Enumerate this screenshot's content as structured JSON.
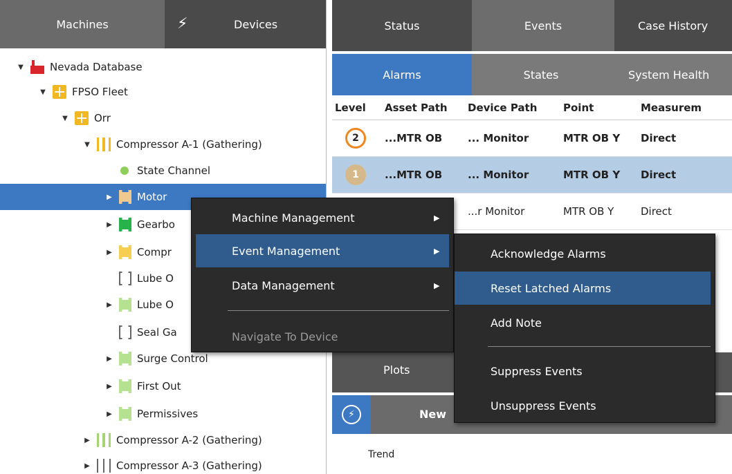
{
  "left_tabs": {
    "machines": "Machines",
    "devices": "Devices"
  },
  "tree": [
    {
      "label": "Nevada Database",
      "icon": "factory-icon",
      "caret": "▼"
    },
    {
      "label": "FPSO Fleet",
      "icon": "folder-grid-icon",
      "caret": "▼"
    },
    {
      "label": "Orr",
      "icon": "folder-grid-icon",
      "caret": "▼"
    },
    {
      "label": "Compressor A-1 (Gathering)",
      "icon": "machine-train-icon",
      "caret": "▼"
    },
    {
      "label": "State Channel",
      "icon": "status-dot-icon",
      "caret": ""
    },
    {
      "label": "Motor",
      "icon": "motor-icon",
      "caret": "▶"
    },
    {
      "label": "Gearbo",
      "icon": "gearbox-icon",
      "caret": "▶"
    },
    {
      "label": "Compr",
      "icon": "compressor-icon",
      "caret": "▶"
    },
    {
      "label": "Lube O",
      "icon": "component-outline-icon",
      "caret": ""
    },
    {
      "label": "Lube O",
      "icon": "component-light-icon",
      "caret": "▶"
    },
    {
      "label": "Seal Ga",
      "icon": "component-outline-icon",
      "caret": ""
    },
    {
      "label": "Surge Control",
      "icon": "component-light-icon",
      "caret": "▶"
    },
    {
      "label": "First Out",
      "icon": "component-light-icon",
      "caret": "▶"
    },
    {
      "label": "Permissives",
      "icon": "component-light-icon",
      "caret": "▶"
    },
    {
      "label": "Compressor A-2 (Gathering)",
      "icon": "machine-train-green-icon",
      "caret": "▶"
    },
    {
      "label": "Compressor A-3 (Gathering)",
      "icon": "machine-train-outline-icon",
      "caret": "▶"
    }
  ],
  "right_tabs": {
    "status": "Status",
    "events": "Events",
    "case_history": "Case History"
  },
  "sub_tabs": {
    "alarms": "Alarms",
    "states": "States",
    "system_health": "System Health"
  },
  "grid": {
    "headers": [
      "Level",
      "Asset Path",
      "Device Path",
      "Point",
      "Measurem"
    ],
    "rows": [
      {
        "level": "2",
        "asset": "...MTR OB",
        "device": "... Monitor",
        "point": "MTR OB Y",
        "meas": "Direct"
      },
      {
        "level": "1",
        "asset": "...MTR OB",
        "device": "... Monitor",
        "point": "MTR OB Y",
        "meas": "Direct"
      },
      {
        "level": "",
        "asset": "",
        "device": "...r Monitor",
        "point": "MTR OB Y",
        "meas": "Direct"
      }
    ]
  },
  "plots": {
    "label": "Plots"
  },
  "new_bar": {
    "label": "New"
  },
  "trend": {
    "label": "Trend"
  },
  "context_menu": {
    "items": [
      {
        "label": "Machine Management",
        "submenu": true
      },
      {
        "label": "Event Management",
        "submenu": true
      },
      {
        "label": "Data Management",
        "submenu": true
      },
      {
        "label": "Navigate To Device",
        "disabled": true
      }
    ]
  },
  "event_submenu": {
    "items": [
      "Acknowledge Alarms",
      "Reset Latched Alarms",
      "Add Note",
      "Suppress Events",
      "Unsuppress Events"
    ]
  },
  "colors": {
    "accent": "#3d78c3",
    "menu_bg": "#2b2b2b",
    "menu_highlight": "#2f5b8d",
    "alarm_level2": "#f0871e",
    "alarm_level1": "#d6b98a"
  }
}
